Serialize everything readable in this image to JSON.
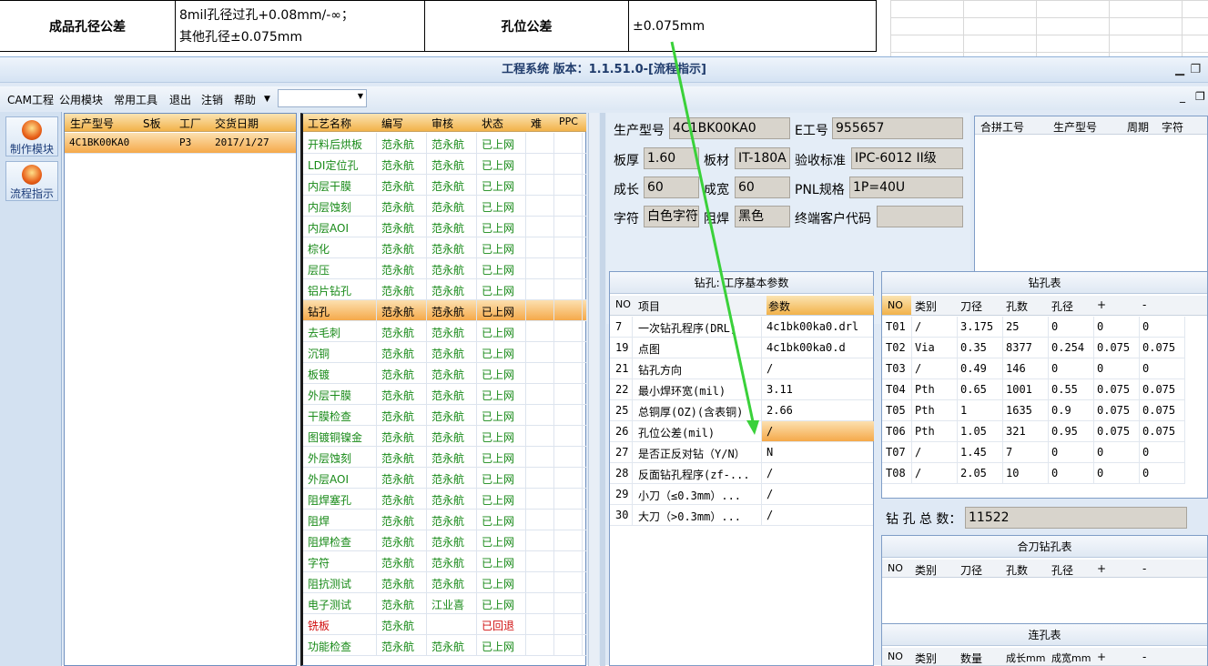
{
  "document": {
    "row1_label": "成品孔径公差",
    "row1_value_line1": "8mil孔径过孔+0.08mm/-∞；",
    "row1_value_line2": "其他孔径±0.075mm",
    "row1_label2": "孔位公差",
    "row1_value2": "±0.075mm"
  },
  "window": {
    "title": "工程系统 版本：1.1.51.0-[流程指示]"
  },
  "menu": {
    "items": [
      "CAM工程",
      "公用模块",
      "常用工具",
      "退出",
      "注销",
      "帮助"
    ]
  },
  "sidebar": {
    "buttons": [
      {
        "label": "制作模块",
        "icon": "flame-icon"
      },
      {
        "label": "流程指示",
        "icon": "flame-icon"
      }
    ]
  },
  "product_grid": {
    "headers": [
      "生产型号",
      "S板",
      "工厂",
      "交货日期"
    ],
    "rows": [
      [
        "4C1BK00KA0",
        "",
        "P3",
        "2017/1/27"
      ]
    ]
  },
  "process_grid": {
    "headers": [
      "工艺名称",
      "编写",
      "审核",
      "状态",
      "难",
      "PPC"
    ],
    "rows": [
      [
        "开料后烘板",
        "范永航",
        "范永航",
        "已上网"
      ],
      [
        "LDI定位孔",
        "范永航",
        "范永航",
        "已上网"
      ],
      [
        "内层干膜",
        "范永航",
        "范永航",
        "已上网"
      ],
      [
        "内层蚀刻",
        "范永航",
        "范永航",
        "已上网"
      ],
      [
        "内层AOI",
        "范永航",
        "范永航",
        "已上网"
      ],
      [
        "棕化",
        "范永航",
        "范永航",
        "已上网"
      ],
      [
        "层压",
        "范永航",
        "范永航",
        "已上网"
      ],
      [
        "铝片钻孔",
        "范永航",
        "范永航",
        "已上网"
      ],
      [
        "钻孔",
        "范永航",
        "范永航",
        "已上网"
      ],
      [
        "去毛刺",
        "范永航",
        "范永航",
        "已上网"
      ],
      [
        "沉铜",
        "范永航",
        "范永航",
        "已上网"
      ],
      [
        "板镀",
        "范永航",
        "范永航",
        "已上网"
      ],
      [
        "外层干膜",
        "范永航",
        "范永航",
        "已上网"
      ],
      [
        "干膜检查",
        "范永航",
        "范永航",
        "已上网"
      ],
      [
        "图镀铜镍金",
        "范永航",
        "范永航",
        "已上网"
      ],
      [
        "外层蚀刻",
        "范永航",
        "范永航",
        "已上网"
      ],
      [
        "外层AOI",
        "范永航",
        "范永航",
        "已上网"
      ],
      [
        "阻焊塞孔",
        "范永航",
        "范永航",
        "已上网"
      ],
      [
        "阻焊",
        "范永航",
        "范永航",
        "已上网"
      ],
      [
        "阻焊检查",
        "范永航",
        "范永航",
        "已上网"
      ],
      [
        "字符",
        "范永航",
        "范永航",
        "已上网"
      ],
      [
        "阻抗测试",
        "范永航",
        "范永航",
        "已上网"
      ],
      [
        "电子测试",
        "范永航",
        "江业喜",
        "已上网"
      ],
      [
        "铣板",
        "范永航",
        "",
        "已回退"
      ],
      [
        "功能检查",
        "范永航",
        "范永航",
        "已上网"
      ]
    ]
  },
  "info": {
    "model_label": "生产型号",
    "model_value": "4C1BK00KA0",
    "e_label": "E工号",
    "e_value": "955657",
    "thick_label": "板厚",
    "thick_value": "1.60",
    "mat_label": "板材",
    "mat_value": "IT-180A",
    "std_label": "验收标准",
    "std_value": "IPC-6012 II级",
    "len_label": "成长",
    "len_value": "60",
    "wid_label": "成宽",
    "wid_value": "60",
    "pnl_label": "PNL规格",
    "pnl_value": "1P=40U",
    "char_label": "字符",
    "char_value": "白色字符",
    "mask_label": "阻焊",
    "mask_value": "黑色",
    "cust_label": "终端客户代码",
    "cust_value": ""
  },
  "combine": {
    "headers": [
      "合拼工号",
      "生产型号",
      "周期",
      "字符"
    ]
  },
  "drill_params": {
    "title": "钻孔: 工序基本参数",
    "headers": [
      "NO",
      "项目",
      "参数"
    ],
    "rows": [
      [
        "7",
        "一次钻孔程序(DRL)",
        "4c1bk00ka0.drl"
      ],
      [
        "19",
        "点图",
        "4c1bk00ka0.d"
      ],
      [
        "21",
        "钻孔方向",
        "/"
      ],
      [
        "22",
        "最小焊环宽(mil)",
        "3.11"
      ],
      [
        "25",
        "总铜厚(OZ)(含表铜)",
        "2.66"
      ],
      [
        "26",
        "孔位公差(mil)",
        "/"
      ],
      [
        "27",
        "是否正反对钻（Y/N）",
        "N"
      ],
      [
        "28",
        "反面钻孔程序(zf-...",
        "/"
      ],
      [
        "29",
        "小刀（≤0.3mm）...",
        "/"
      ],
      [
        "30",
        "大刀（>0.3mm）...",
        "/"
      ]
    ]
  },
  "drill_table": {
    "title": "钻孔表",
    "headers": [
      "NO",
      "类别",
      "刀径",
      "孔数",
      "孔径",
      "+",
      "-"
    ],
    "rows": [
      [
        "T01",
        "/",
        "3.175",
        "25",
        "0",
        "0",
        "0"
      ],
      [
        "T02",
        "Via",
        "0.35",
        "8377",
        "0.254",
        "0.075",
        "0.075"
      ],
      [
        "T03",
        "/",
        "0.49",
        "146",
        "0",
        "0",
        "0"
      ],
      [
        "T04",
        "Pth",
        "0.65",
        "1001",
        "0.55",
        "0.075",
        "0.075"
      ],
      [
        "T05",
        "Pth",
        "1",
        "1635",
        "0.9",
        "0.075",
        "0.075"
      ],
      [
        "T06",
        "Pth",
        "1.05",
        "321",
        "0.95",
        "0.075",
        "0.075"
      ],
      [
        "T07",
        "/",
        "1.45",
        "7",
        "0",
        "0",
        "0"
      ],
      [
        "T08",
        "/",
        "2.05",
        "10",
        "0",
        "0",
        "0"
      ]
    ],
    "total_label": "钻 孔 总 数：",
    "total_value": "11522"
  },
  "combo_drill": {
    "title": "合刀钻孔表",
    "headers": [
      "NO",
      "类别",
      "刀径",
      "孔数",
      "孔径",
      "+",
      "-"
    ]
  },
  "slot_table": {
    "title": "连孔表",
    "headers": [
      "NO",
      "类别",
      "数量",
      "成长mm",
      "成宽mm",
      "+",
      "-"
    ]
  },
  "colors": {
    "accent": "#f5a94a",
    "arrow": "#3ad13a",
    "status_ok": "#188a18",
    "status_back": "#d01010"
  }
}
